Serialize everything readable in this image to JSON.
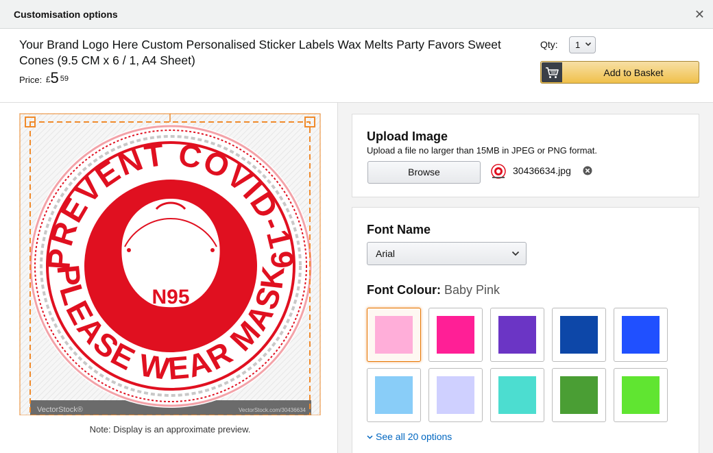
{
  "modal": {
    "title": "Customisation options",
    "close_icon": "close-icon"
  },
  "product": {
    "title": "Your Brand Logo Here Custom Personalised Sticker Labels Wax Melts Party Favors Sweet Cones (9.5 CM x 6 / 1, A4 Sheet)",
    "price_label": "Price:",
    "price_currency": "£",
    "price_whole": "5",
    "price_fraction": "59"
  },
  "qty": {
    "label": "Qty:",
    "value": "1"
  },
  "basket": {
    "label": "Add to Basket",
    "icon": "cart-icon"
  },
  "preview": {
    "sticker_top_text": "PREVENT COVID-19",
    "sticker_bottom_text": "PLEASE WEAR MASK",
    "sticker_center_text": "N95",
    "watermark_left": "VectorStock®",
    "watermark_right": "VectorStock.com/30436634",
    "note": "Note: Display is an approximate preview.",
    "sticker_color": "#e01020"
  },
  "upload": {
    "title": "Upload Image",
    "help": "Upload a file no larger than 15MB in JPEG or PNG format.",
    "browse_label": "Browse",
    "file_name": "30436634.jpg",
    "remove_icon": "remove-circle-icon"
  },
  "font": {
    "title": "Font Name",
    "selected": "Arial",
    "colour_label": "Font Colour:",
    "colour_value": "Baby Pink",
    "swatches": [
      {
        "color": "#ffaed9",
        "selected": true
      },
      {
        "color": "#ff1f96",
        "selected": false
      },
      {
        "color": "#6b35c5",
        "selected": false
      },
      {
        "color": "#0d47a8",
        "selected": false
      },
      {
        "color": "#2050ff",
        "selected": false
      },
      {
        "color": "#89cdf8",
        "selected": false
      },
      {
        "color": "#cfd0ff",
        "selected": false
      },
      {
        "color": "#4cddd0",
        "selected": false
      },
      {
        "color": "#4a9e34",
        "selected": false
      },
      {
        "color": "#60e531",
        "selected": false
      }
    ],
    "see_all_label": "See all 20 options"
  }
}
